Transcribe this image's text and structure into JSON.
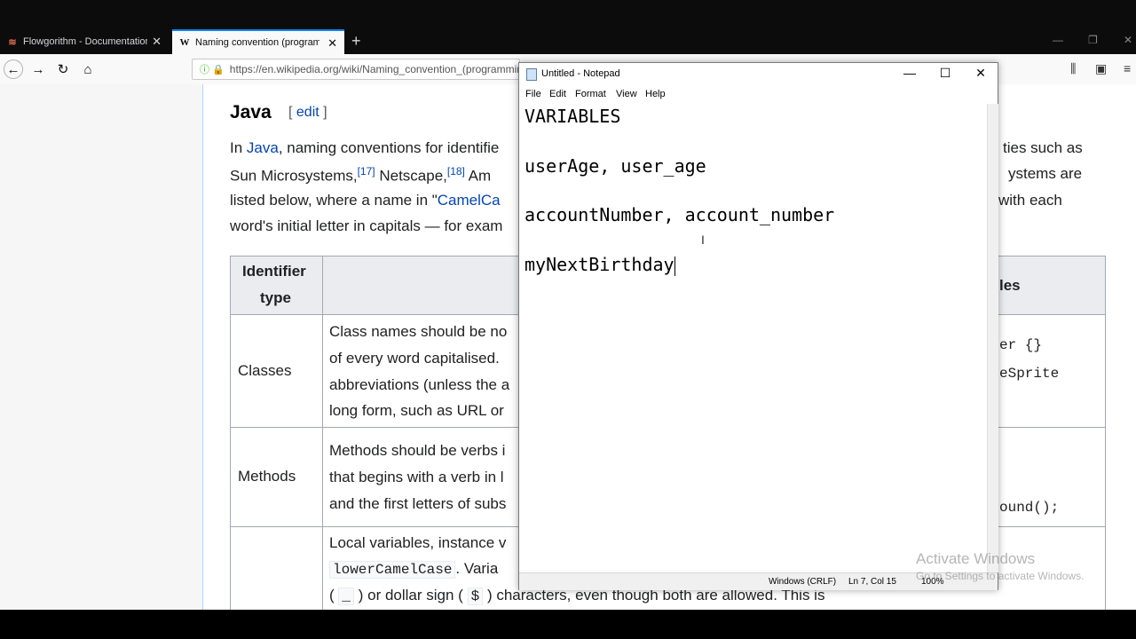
{
  "browser": {
    "tabs": [
      {
        "title": "Flowgorithm - Documentation",
        "icon": "flowgorithm-icon"
      },
      {
        "title": "Naming convention (programming)",
        "icon": "wikipedia-icon"
      }
    ],
    "url": "https://en.wikipedia.org/wiki/Naming_convention_(programming)"
  },
  "article": {
    "section_title": "Java",
    "edit_open": "[",
    "edit_link": "edit",
    "edit_close": "]",
    "paragraph": {
      "l1a": "In ",
      "l1_link": "Java",
      "l1b": ", naming conventions for identifie",
      "l1_right": "ties such as",
      "l2a": "Sun Microsystems,",
      "l2_ref1": "[17]",
      "l2b": " Netscape,",
      "l2_ref2": "[18]",
      "l2c": " Am",
      "l2_right": "ystems are",
      "l3a": "listed below, where a name in \"",
      "l3_link": "CamelCa",
      "l3_right": "with each",
      "l4": "word's initial letter in capitals — for exam"
    },
    "table": {
      "header_col1_l1": "Identifier",
      "header_col1_l2": "type",
      "header_col3": "les",
      "rows": [
        {
          "type": "Classes",
          "desc": [
            "Class names should be no",
            "of every word capitalised.",
            "abbreviations (unless the a",
            "long form, such as URL or"
          ],
          "examples": [
            "er {}",
            "eSprite"
          ]
        },
        {
          "type": "Methods",
          "desc": [
            "Methods should be verbs i",
            "that begins with a verb in l",
            "and the first letters of subs"
          ],
          "examples": [
            "ound();"
          ]
        },
        {
          "type": "",
          "desc_l1": "Local variables, instance v",
          "desc_l2_code": "lowerCamelCase",
          "desc_l2_rest": ". Varia",
          "desc_l3_a": "(",
          "desc_l3_code1": "_",
          "desc_l3_b": ") or dollar sign (",
          "desc_l3_code2": "$",
          "desc_l3_c": ") characters, even though both are allowed. This is"
        }
      ]
    }
  },
  "notepad": {
    "title": "Untitled - Notepad",
    "menu": [
      "File",
      "Edit",
      "Format",
      "View",
      "Help"
    ],
    "lines": [
      "VARIABLES",
      "",
      "userAge, user_age",
      "",
      "accountNumber, account_number",
      "",
      "myNextBirthday"
    ],
    "status": {
      "line_ending": "Windows (CRLF)",
      "position": "Ln 7, Col 15",
      "zoom": "100%"
    }
  },
  "watermark": {
    "line1": "Activate Windows",
    "line2": "Go to Settings to activate Windows."
  }
}
